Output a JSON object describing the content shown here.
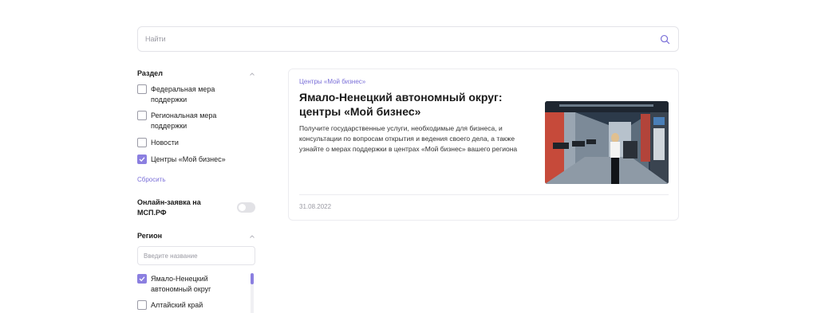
{
  "search": {
    "placeholder": "Найти",
    "icon": "search-icon"
  },
  "filters": {
    "section": {
      "title": "Раздел",
      "items": [
        {
          "label": "Федеральная мера поддержки",
          "checked": false
        },
        {
          "label": "Региональная мера поддержки",
          "checked": false
        },
        {
          "label": "Новости",
          "checked": false
        },
        {
          "label": "Центры «Мой бизнес»",
          "checked": true
        }
      ],
      "reset_label": "Сбросить"
    },
    "online": {
      "label": "Онлайн-заявка на МСП.РФ",
      "enabled": false
    },
    "region": {
      "title": "Регион",
      "placeholder": "Введите название",
      "items": [
        {
          "label": "Ямало-Ненецкий автономный округ",
          "checked": true
        },
        {
          "label": "Алтайский край",
          "checked": false
        }
      ]
    }
  },
  "results": [
    {
      "tag": "Центры «Мой бизнес»",
      "title": "Ямало-Ненецкий автономный округ: центры «Мой бизнес»",
      "description": "Получите государственные услуги, необходимые для бизнеса, и консультации по вопросам открытия и ведения своего дела, а также узнайте о мерах поддержки в центрах «Мой бизнес» вашего региона",
      "date": "31.08.2022"
    }
  ],
  "colors": {
    "accent": "#8b7fe0",
    "border": "#e3e3e8",
    "muted": "#9a9aa3"
  }
}
